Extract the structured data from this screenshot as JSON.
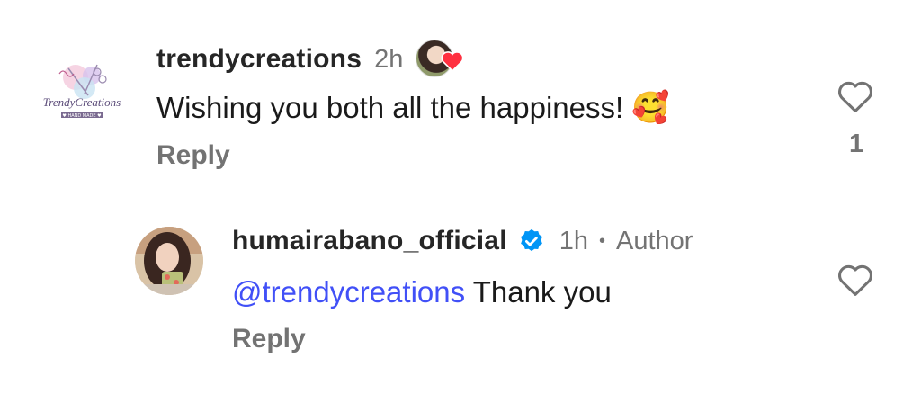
{
  "comment": {
    "username": "trendycreations",
    "time": "2h",
    "text": "Wishing you both all the happiness!",
    "emoji": "🥰",
    "reply_label": "Reply",
    "like_count": "1",
    "avatar_logo_text": "TrendyCreations",
    "avatar_logo_subtext": "♥ HAND MADE ♥"
  },
  "reply": {
    "username": "humairabano_official",
    "time": "1h",
    "separator": "•",
    "author_label": "Author",
    "mention": "@trendycreations",
    "text": "Thank you",
    "reply_label": "Reply"
  },
  "colors": {
    "mention": "#4150f7",
    "verified": "#0095f6",
    "heart_reaction": "#ff3040",
    "secondary_text": "#737373"
  }
}
